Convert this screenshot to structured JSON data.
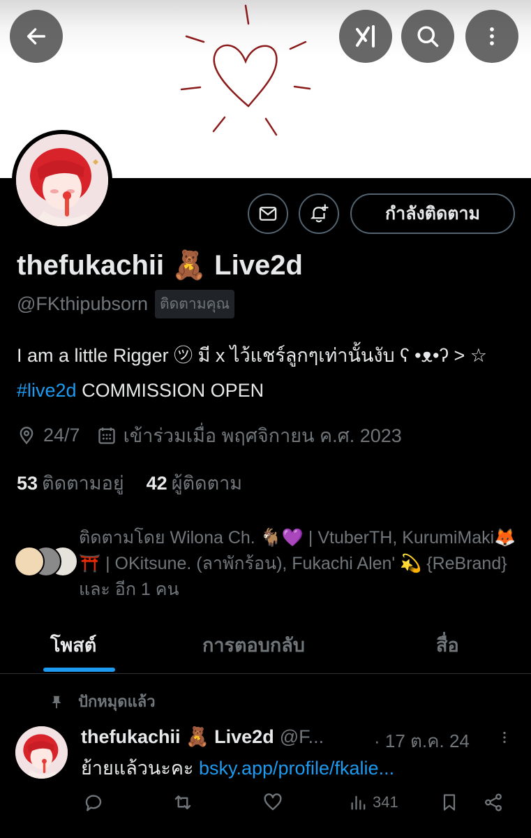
{
  "profile": {
    "display_name": "thefukachii 🧸 Live2d",
    "handle": "@FKthipubsorn",
    "follows_you_badge": "ติดตามคุณ",
    "bio_text": "I am a little Rigger ㋡ มี x ไว้แชร์ลูกๆเท่านั้นงับ  ʕ •ᴥ•ʔ > ☆ ",
    "bio_hashtag": "#live2d",
    "bio_suffix": " COMMISSION OPEN",
    "location": "24/7",
    "joined": "เข้าร่วมเมื่อ พฤศจิกายน ค.ศ. 2023",
    "following_count": "53",
    "following_label": "ติดตามอยู่",
    "followers_count": "42",
    "followers_label": "ผู้ติดตาม",
    "followed_by_text": "ติดตามโดย Wilona Ch. 🐐💜 | VtuberTH, KurumiMaki🦊⛩️ | OKitsune. (ลาพักร้อน), Fukachi Alen' 💫 {ReBrand} และ อีก 1 คน"
  },
  "buttons": {
    "following_label": "กำลังติดตาม"
  },
  "tabs": [
    {
      "label": "โพสต์",
      "active": true
    },
    {
      "label": "การตอบกลับ",
      "active": false
    },
    {
      "label": "สื่อ",
      "active": false
    }
  ],
  "pinned_post": {
    "pinned_label": "ปักหมุดแล้ว",
    "author_name": "thefukachii 🧸 Live2d",
    "author_handle": "@F...",
    "date": "· 17 ต.ค. 24",
    "text": "ย้ายแล้วนะคะ ",
    "link": "bsky.app/profile/fkalie...",
    "views": "341"
  },
  "icons": {
    "top_left": "back-arrow-icon",
    "top_right": [
      "grok-icon",
      "search-icon",
      "more-vertical-icon"
    ],
    "profile_buttons": [
      "mail-icon",
      "notification-bell-icon"
    ],
    "meta": [
      "location-pin-icon",
      "calendar-icon"
    ],
    "post_actions": [
      "reply-icon",
      "repost-icon",
      "like-icon",
      "views-icon",
      "bookmark-icon",
      "share-icon"
    ]
  },
  "colors": {
    "accent": "#1d9bf0",
    "text_primary": "#e7e9ea",
    "text_secondary": "#71767b",
    "background": "#000000",
    "banner_heart": "#8b1a1a"
  }
}
